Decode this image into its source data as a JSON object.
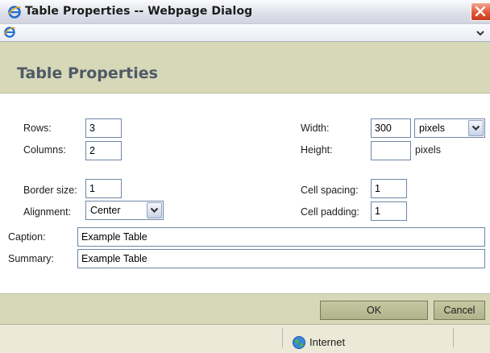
{
  "window": {
    "title": "Table Properties -- Webpage Dialog",
    "icon": "ie-icon",
    "close_icon": "close-icon"
  },
  "address_bar": {
    "icon": "ie-icon",
    "dropdown_icon": "chevron-down-icon"
  },
  "dialog": {
    "heading": "Table Properties"
  },
  "form": {
    "rows": {
      "label": "Rows:",
      "value": "3"
    },
    "columns": {
      "label": "Columns:",
      "value": "2"
    },
    "width": {
      "label": "Width:",
      "value": "300",
      "unit_selected": "pixels"
    },
    "height": {
      "label": "Height:",
      "value": "",
      "unit": "pixels"
    },
    "border_size": {
      "label": "Border size:",
      "value": "1"
    },
    "alignment": {
      "label": "Alignment:",
      "selected": "Center"
    },
    "cell_spacing": {
      "label": "Cell spacing:",
      "value": "1"
    },
    "cell_padding": {
      "label": "Cell padding:",
      "value": "1"
    },
    "caption": {
      "label": "Caption:",
      "value": "Example Table"
    },
    "summary": {
      "label": "Summary:",
      "value": "Example Table"
    }
  },
  "buttons": {
    "ok": "OK",
    "cancel": "Cancel"
  },
  "status_bar": {
    "zone": "Internet",
    "zone_icon": "globe-icon"
  },
  "colors": {
    "header_band": "#d6d8b8",
    "heading_text": "#4f5a66",
    "button_fill": "#b8ba92",
    "field_border": "#6f87a7",
    "close_button": "#e2573a"
  }
}
